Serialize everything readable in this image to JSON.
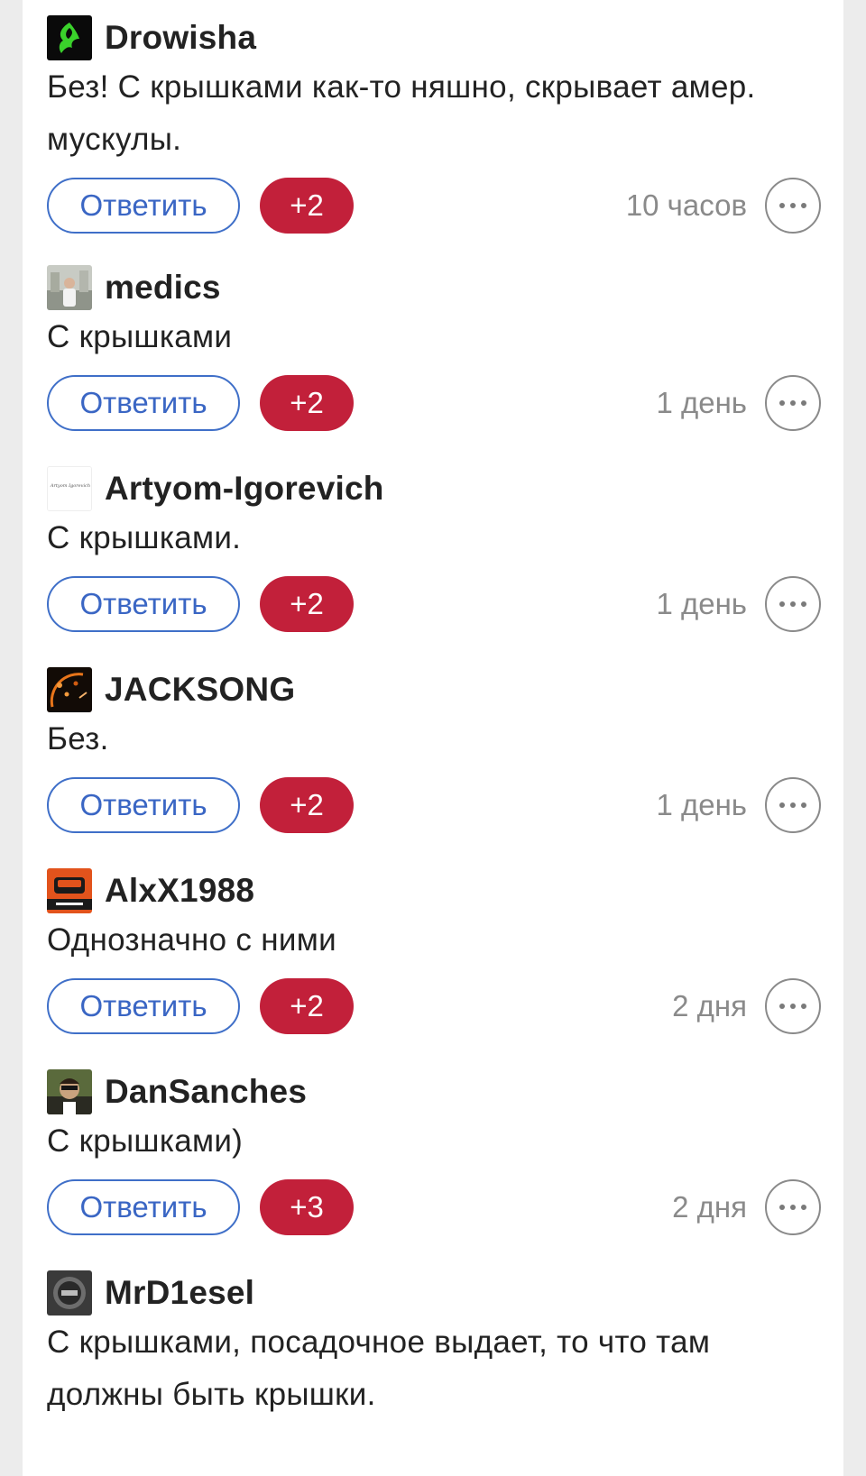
{
  "comments": [
    {
      "username": "Drowisha",
      "avatar_icon": "razer-logo-avatar",
      "text": "Без! С крышками как-то няшно, скрывает амер. мускулы.",
      "reply_label": "Ответить",
      "score": "+2",
      "time": "10 часов",
      "more_icon": "more-horizontal-icon"
    },
    {
      "username": "medics",
      "avatar_icon": "photo-avatar",
      "text": "С крышками",
      "reply_label": "Ответить",
      "score": "+2",
      "time": "1 день",
      "more_icon": "more-horizontal-icon"
    },
    {
      "username": "Artyom-Igorevich",
      "avatar_icon": "signature-avatar",
      "avatar_text": "Artyom Igorevich",
      "text": "С крышками.",
      "reply_label": "Ответить",
      "score": "+2",
      "time": "1 день",
      "more_icon": "more-horizontal-icon"
    },
    {
      "username": "JACKSONG",
      "avatar_icon": "gauge-avatar",
      "text": "Без.",
      "reply_label": "Ответить",
      "score": "+2",
      "time": "1 день",
      "more_icon": "more-horizontal-icon"
    },
    {
      "username": "AlxX1988",
      "avatar_icon": "car-logo-avatar",
      "text": "Однозначно с ними",
      "reply_label": "Ответить",
      "score": "+2",
      "time": "2 дня",
      "more_icon": "more-horizontal-icon"
    },
    {
      "username": "DanSanches",
      "avatar_icon": "person-photo-avatar",
      "text": "С крышками)",
      "reply_label": "Ответить",
      "score": "+3",
      "time": "2 дня",
      "more_icon": "more-horizontal-icon"
    },
    {
      "username": "MrD1esel",
      "avatar_icon": "badge-avatar",
      "text": "С крышками, посадочное выдает, то что там должны быть крышки.",
      "reply_label": "",
      "score": "",
      "time": "",
      "more_icon": "more-horizontal-icon"
    }
  ],
  "colors": {
    "reply_accent": "#3a66c4",
    "score_bg": "#c2203a",
    "time_text": "#8a8a8a",
    "page_bg": "#ececec"
  }
}
